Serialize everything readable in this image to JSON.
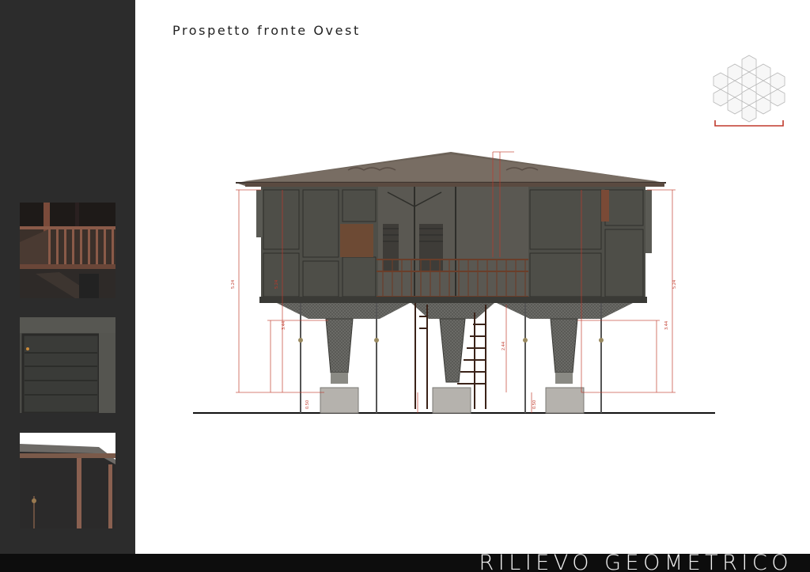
{
  "sheet": {
    "title": "Prospetto fronte Ovest",
    "footer_label": "RILIEVO GEOMETRICO"
  },
  "thumbnails": [
    {
      "icon": "balcony-photo-icon"
    },
    {
      "icon": "wood-panel-photo-icon"
    },
    {
      "icon": "roof-eave-photo-icon"
    }
  ],
  "keyplan": {
    "icon": "hexagonal-key-plan-icon",
    "accent": "#c0392b"
  },
  "dimensions": {
    "overall_height": "5.24",
    "pillar_height": "3.44",
    "stair_height": "2.44",
    "base_height": "0.50"
  },
  "colors": {
    "sidebar": "#2c2c2c",
    "footer": "#0d0d0d",
    "dimension_lines": "#c0392b",
    "wall": "#4a4a44"
  }
}
